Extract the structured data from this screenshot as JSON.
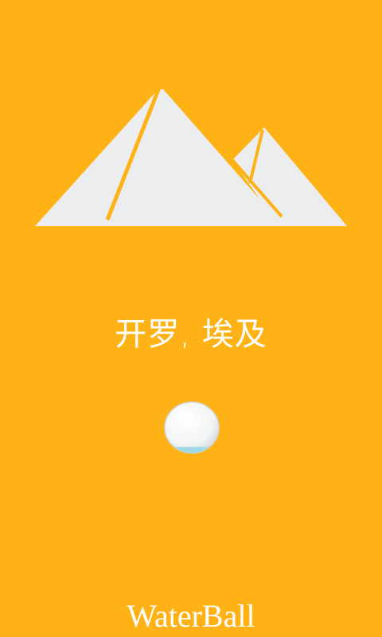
{
  "colors": {
    "background": "#FEB216",
    "pyramid": "#ECEDEE",
    "text": "#FFFFFF",
    "ball_water": "#9FD9E6"
  },
  "city": {
    "icon": "pyramids-icon",
    "label": "开罗, 埃及"
  },
  "ball": {
    "icon": "water-ball-icon",
    "water_level": 0.12
  },
  "app": {
    "name": "WaterBall"
  }
}
